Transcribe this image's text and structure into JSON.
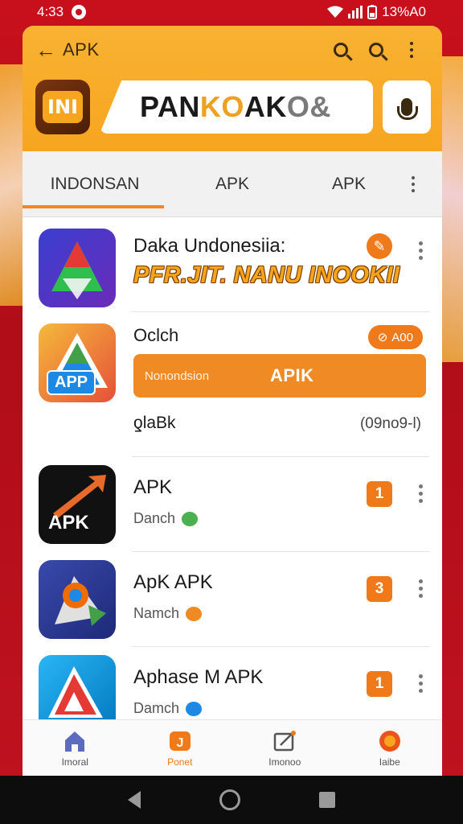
{
  "status_bar": {
    "time": "4:33",
    "right_text": "13%A0"
  },
  "header": {
    "back_label": "APK",
    "logo_text": "INI",
    "search_text_1": "PAN",
    "search_text_2": "K",
    "search_text_3": "O",
    "search_text_4": " AK",
    "search_text_5": "O",
    "search_text_6": "&"
  },
  "tabs": [
    {
      "label": "INDONSAN"
    },
    {
      "label": "APK"
    },
    {
      "label": "APK"
    }
  ],
  "list": {
    "promo": {
      "title": "Daka Undonesiia:",
      "subtitle": "PFR.JIT. NANU INOOKII"
    },
    "featured": {
      "title": "Oclch",
      "add_label": "A00",
      "bar_note": "Nonondsion",
      "bar_label": "APIK",
      "icon_text": "APP",
      "footer_left": "ƍlaBk",
      "footer_right": "(09no9-l)"
    },
    "items": [
      {
        "title": "APK",
        "subtitle": "Danch",
        "rank": "1",
        "icon_text": "APK"
      },
      {
        "title": "ApK APK",
        "subtitle": "Namch",
        "rank": "3",
        "icon_text": ""
      },
      {
        "title": "Aphase M APK",
        "subtitle": "Damch",
        "rank": "1",
        "icon_text": ""
      }
    ]
  },
  "bottom_nav": [
    {
      "label": "Imoral",
      "active": false
    },
    {
      "label": "Ponet",
      "active": true
    },
    {
      "label": "Imonoo",
      "active": false
    },
    {
      "label": "Iaibe",
      "active": false
    }
  ],
  "colors": {
    "accent": "#f7a51f",
    "accent_dark": "#f07a1a",
    "background_red": "#c8101c"
  }
}
